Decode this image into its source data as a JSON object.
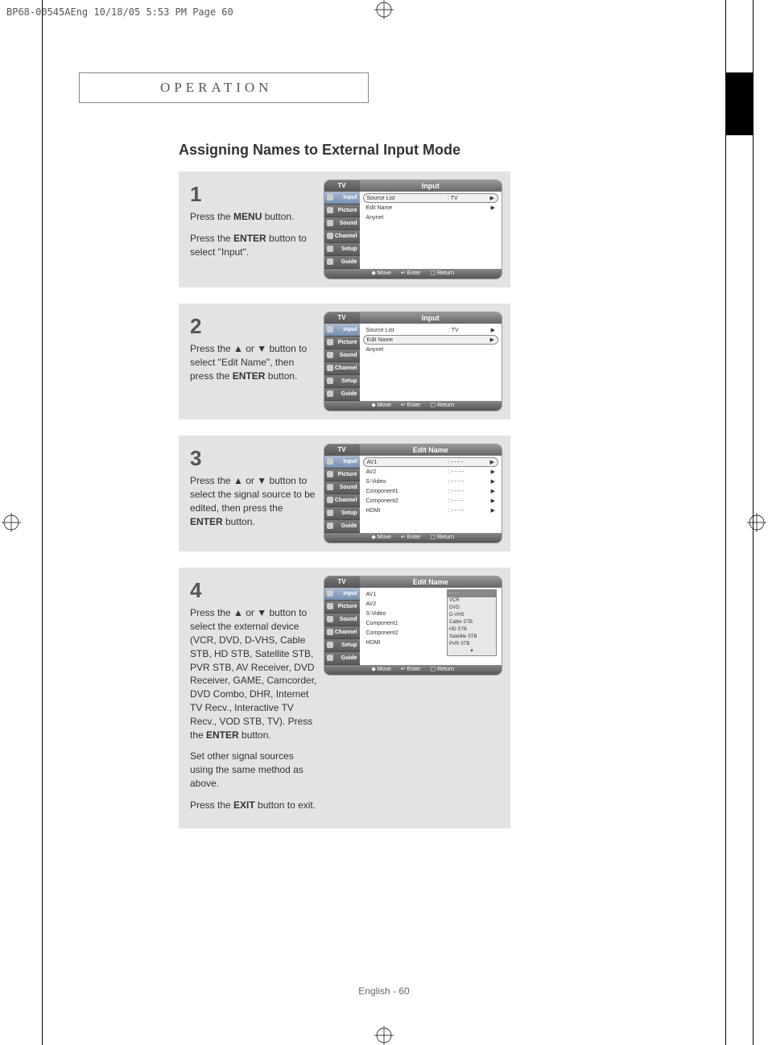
{
  "crop_header": "BP68-00545AEng  10/18/05  5:53 PM  Page 60",
  "tab_label": "OPERATION",
  "section_title": "Assigning Names to External Input Mode",
  "steps": {
    "s1": {
      "num": "1",
      "l1": "Press the ",
      "b1": "MENU",
      "l1b": " button.",
      "l2": "Press the ",
      "b2": "ENTER",
      "l2b": " button to select \"Input\"."
    },
    "s2": {
      "num": "2",
      "l1": "Press the ▲ or ▼ button to select \"Edit Name\", then press the ",
      "b1": "ENTER",
      "l1b": " button."
    },
    "s3": {
      "num": "3",
      "l1": "Press the ▲ or ▼ button to select the signal source to be edited, then press the ",
      "b1": "ENTER",
      "l1b": " button."
    },
    "s4": {
      "num": "4",
      "l1": "Press the ▲ or ▼ button to select the external device (VCR, DVD, D-VHS, Cable STB, HD STB, Satellite STB, PVR STB, AV Receiver, DVD Receiver, GAME, Camcorder, DVD Combo, DHR, Internet TV Recv., Interactive TV Recv., VOD STB, TV). Press the ",
      "b1": "ENTER",
      "l1b": " button.",
      "l2": "Set other signal sources using the same method as above.",
      "l3": "Press the ",
      "b3": "EXIT",
      "l3b": " button to exit."
    }
  },
  "osd": {
    "tv": "TV",
    "title_input": "Input",
    "title_edit": "Edit Name",
    "side": {
      "input": "Input",
      "picture": "Picture",
      "sound": "Sound",
      "channel": "Channel",
      "setup": "Setup",
      "guide": "Guide"
    },
    "menu1": {
      "r1": {
        "lab": "Source List",
        "val": ": TV"
      },
      "r2": {
        "lab": "Edit Name",
        "val": ""
      },
      "r3": {
        "lab": "Anynet",
        "val": ""
      }
    },
    "menu3": {
      "r1": {
        "lab": "AV1",
        "val": ": - - - -"
      },
      "r2": {
        "lab": "AV2",
        "val": ": - - - -"
      },
      "r3": {
        "lab": "S-Video",
        "val": ": - - - -"
      },
      "r4": {
        "lab": "Component1",
        "val": ": - - - -"
      },
      "r5": {
        "lab": "Component2",
        "val": ": - - - -"
      },
      "r6": {
        "lab": "HDMI",
        "val": ": - - - -"
      }
    },
    "menu4": {
      "r1": {
        "lab": "AV1",
        "val": ":"
      },
      "r2": {
        "lab": "AV2",
        "val": ":"
      },
      "r3": {
        "lab": "S-Video",
        "val": ":"
      },
      "r4": {
        "lab": "Component1",
        "val": ":"
      },
      "r5": {
        "lab": "Component2",
        "val": ":"
      },
      "r6": {
        "lab": "HDMI",
        "val": ":"
      }
    },
    "dropdown": {
      "d0": "- - - -",
      "d1": "VCR",
      "d2": "DVD",
      "d3": "D-VHS",
      "d4": "Cable STB",
      "d5": "HD STB",
      "d6": "Satellite STB",
      "d7": "PVR STB",
      "d8": "▼"
    },
    "footer": {
      "move": "Move",
      "enter": "Enter",
      "return": "Return",
      "arrow": "◆",
      "enter_icon": "↵",
      "return_icon": "▢"
    }
  },
  "page_foot": {
    "lang": "English - ",
    "num": "60"
  }
}
